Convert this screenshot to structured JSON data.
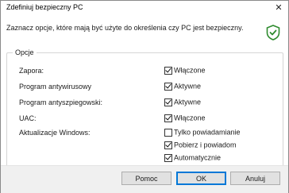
{
  "window": {
    "title": "Zdefiniuj bezpieczny PC",
    "close_glyph": "✕"
  },
  "description": "Zaznacz opcje, które mają być użyte do określenia czy PC jest bezpieczny.",
  "shield_icon": {
    "name": "shield-check-icon",
    "color": "#2e8b2e"
  },
  "options_group": {
    "legend": "Opcje",
    "rows": [
      {
        "label": "Zapora:",
        "choices": [
          {
            "text": "Włączone",
            "checked": true
          }
        ]
      },
      {
        "label": "Program antywirusowy",
        "choices": [
          {
            "text": "Aktywne",
            "checked": true
          }
        ]
      },
      {
        "label": "Program antyszpiegowski:",
        "choices": [
          {
            "text": "Aktywne",
            "checked": true
          }
        ]
      },
      {
        "label": "UAC:",
        "choices": [
          {
            "text": "Włączone",
            "checked": true
          }
        ]
      },
      {
        "label": "Aktualizacje Windows:",
        "choices": [
          {
            "text": "Tylko powiadamianie",
            "checked": false
          },
          {
            "text": "Pobierz i powiadom",
            "checked": true
          },
          {
            "text": "Automatycznie",
            "checked": true
          }
        ]
      }
    ]
  },
  "buttons": {
    "help": "Pomoc",
    "ok": "OK",
    "cancel": "Anuluj"
  }
}
